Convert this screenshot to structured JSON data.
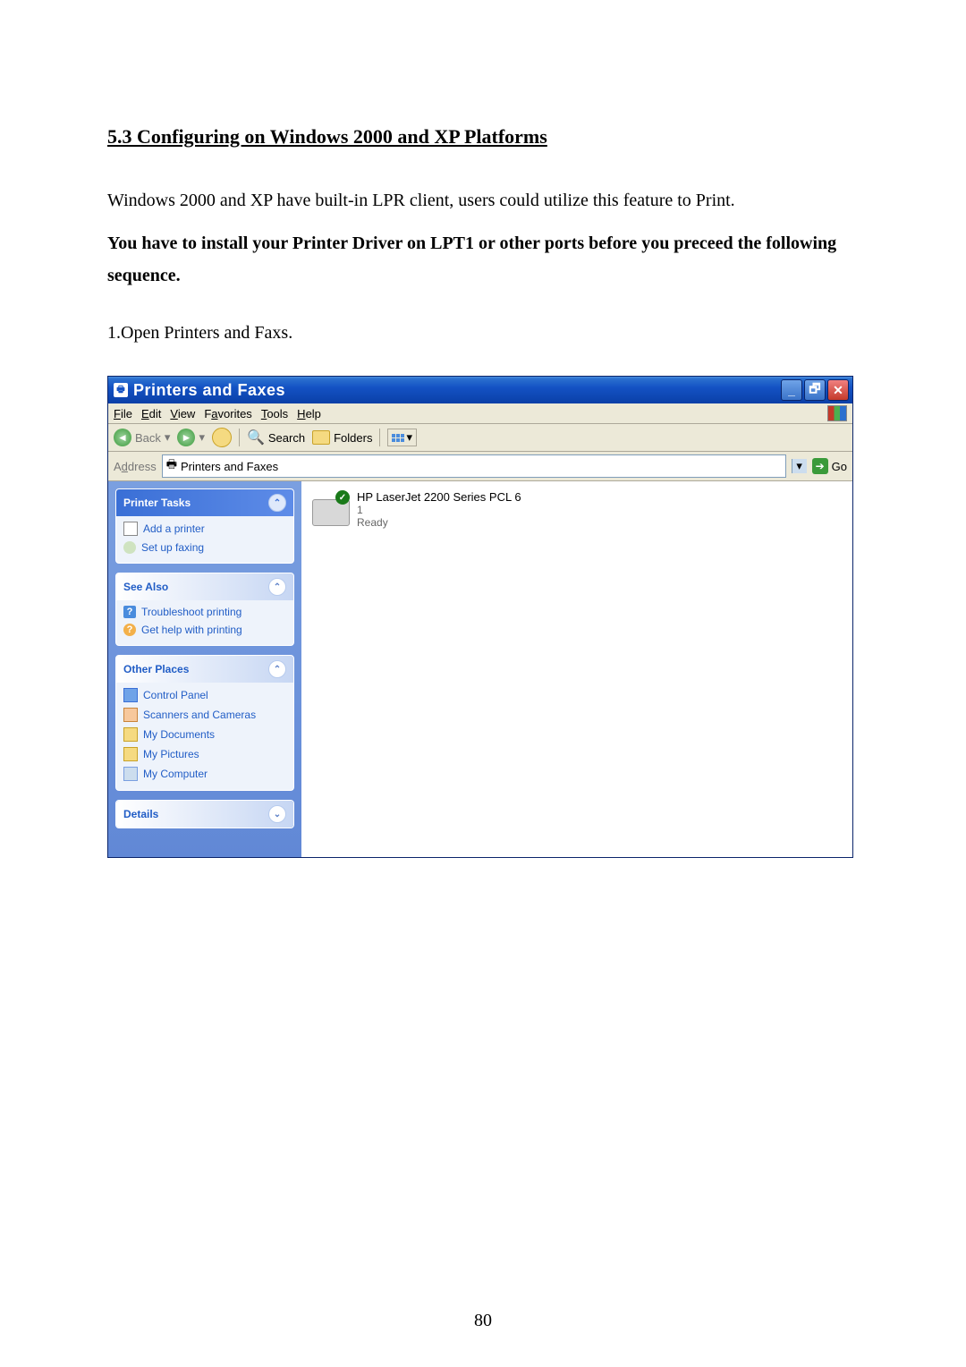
{
  "heading": "5.3 Configuring on Windows 2000 and XP Platforms",
  "para1": "Windows 2000 and XP have built-in LPR client, users could utilize this feature to Print.",
  "para2": "You have to install your Printer Driver on LPT1 or other ports before you preceed the following sequence.",
  "step1": "1.Open Printers and Faxs.",
  "page_number": "80",
  "window": {
    "title": "Printers and Faxes",
    "menu": {
      "file": "File",
      "edit": "Edit",
      "view": "View",
      "favorites": "Favorites",
      "tools": "Tools",
      "help": "Help"
    },
    "toolbar": {
      "back": "Back",
      "search": "Search",
      "folders": "Folders"
    },
    "addressbar": {
      "label": "Address",
      "value": "Printers and Faxes",
      "go": "Go"
    },
    "sidebar": {
      "printer_tasks": {
        "title": "Printer Tasks",
        "add": "Add a printer",
        "fax": "Set up faxing"
      },
      "see_also": {
        "title": "See Also",
        "troubleshoot": "Troubleshoot printing",
        "gethelp": "Get help with printing"
      },
      "other_places": {
        "title": "Other Places",
        "cpanel": "Control Panel",
        "scanners": "Scanners and Cameras",
        "docs": "My Documents",
        "pics": "My Pictures",
        "computer": "My Computer"
      },
      "details": {
        "title": "Details"
      }
    },
    "content": {
      "printer_name": "HP LaserJet 2200 Series PCL 6",
      "printer_count": "1",
      "printer_status": "Ready"
    }
  }
}
